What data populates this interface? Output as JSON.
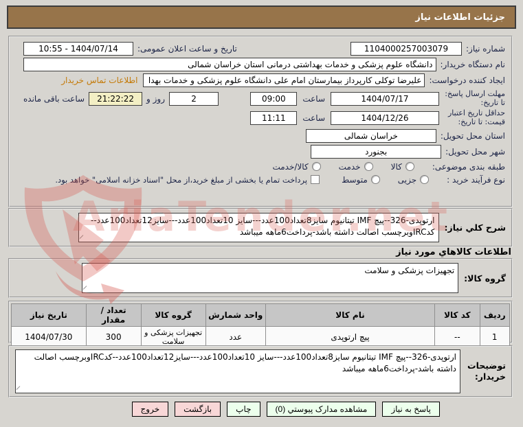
{
  "page_title": "جزئیات اطلاعات نیاز",
  "watermark": {
    "text": "AriaTender.net"
  },
  "form": {
    "need_number": {
      "label": "شماره نیاز:",
      "value": "1104000257003079"
    },
    "announce": {
      "label": "تاریخ و ساعت اعلان عمومی:",
      "value": "1404/07/14 - 10:55"
    },
    "buyer_name": {
      "label": "نام دستگاه خریدار:",
      "value": "دانشگاه علوم پزشکی و خدمات بهداشتی درمانی استان خراسان شمالی"
    },
    "creator": {
      "label": "ایجاد کننده درخواست:",
      "value": "علیرضا توکلی کارپرداز بیمارستان امام علی دانشگاه علوم پزشکی و خدمات بهدا",
      "contact_link": "اطلاعات تماس خریدار"
    },
    "deadline": {
      "label": "مهلت ارسال پاسخ: تا تاریخ:",
      "date": "1404/07/17",
      "hour_label": "ساعت",
      "time": "09:00",
      "days_value": "2",
      "days_label": "روز و",
      "remain_time": "21:22:22",
      "remain_label": "ساعت باقی مانده"
    },
    "validity": {
      "label": "حداقل تاریخ اعتبار قیمت: تا تاریخ:",
      "date": "1404/12/26",
      "hour_label": "ساعت",
      "time": "11:11"
    },
    "province": {
      "label": "استان محل تحویل:",
      "value": "خراسان شمالی"
    },
    "city": {
      "label": "شهر محل تحویل:",
      "value": "بجنورد"
    },
    "classification": {
      "label": "طبقه بندی موضوعی:",
      "options": [
        "کالا",
        "خدمت",
        "کالا/خدمت"
      ]
    },
    "process_type": {
      "label": "نوع فرآیند خرید :",
      "options": [
        "جزیی",
        "متوسط"
      ],
      "checkbox_label": "پرداخت تمام یا بخشی از مبلغ خرید،از محل \"اسناد خزانه اسلامی\" خواهد بود."
    }
  },
  "need_desc": {
    "label": "شرح کلي نياز:",
    "value": "ارتوپدی-326--پیچ IMF تیتانیوم سایز8تعداد100عدد---سایز 10تعداد100عدد---سایز12تعداد100عدد--کدIRCوبرچسب اصالت داشته باشد-پرداخت6ماهه میباشد"
  },
  "goods_section_title": "اطلاعات کالاهاي مورد نياز",
  "goods_group": {
    "label": "گروه کالا:",
    "value": "تجهیزات پزشکی و سلامت"
  },
  "table": {
    "headers": [
      "ردیف",
      "کد کالا",
      "نام کالا",
      "واحد شمارش",
      "گروه کالا",
      "تعداد / مقدار",
      "تاریخ نیاز"
    ],
    "rows": [
      {
        "cells": [
          "1",
          "--",
          "پیچ ارتوپدی",
          "عدد",
          "تجهیزات پزشکی و سلامت",
          "300",
          "1404/07/30"
        ]
      }
    ]
  },
  "buyer_notes": {
    "label": "توضیحات خریدار:",
    "value": "ارتوپدی-326--پیچ IMF تیتانیوم سایز8تعداد100عدد---سایز 10تعداد100عدد---سایز12تعداد100عدد--کدIRCوبرچسب اصالت داشته باشد-پرداخت6ماهه میباشد"
  },
  "buttons": {
    "respond": "پاسخ به نیاز",
    "attachments": "مشاهده مدارک پیوستي (0)",
    "print": "چاپ",
    "back": "بازگشت",
    "exit": "خروج"
  },
  "colors": {
    "header": "#97744a",
    "highlight": "#f3efc4",
    "link": "#c47a08",
    "btn_green": "#ecffec",
    "btn_pink": "#f8d7d7"
  }
}
